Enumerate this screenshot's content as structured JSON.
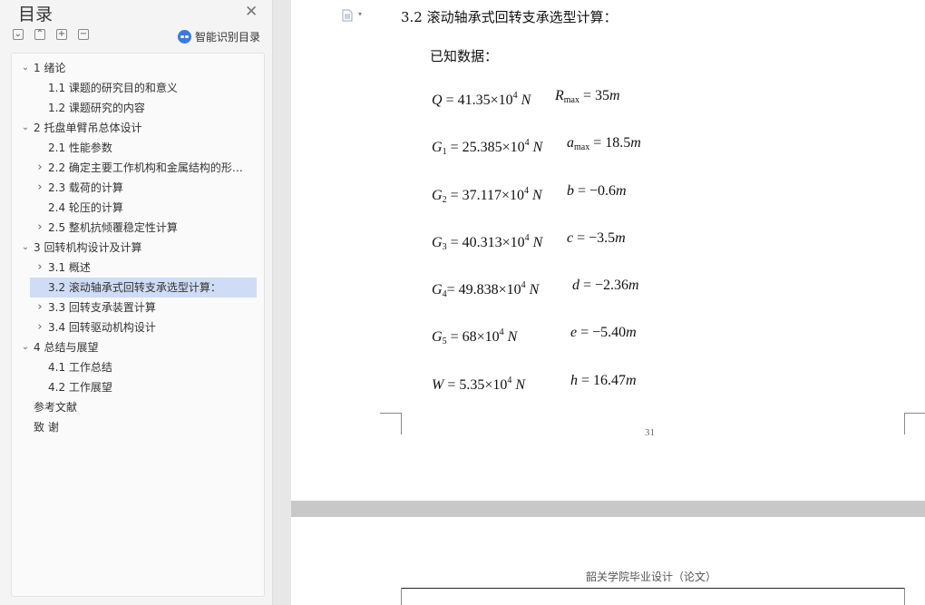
{
  "sidebar": {
    "title": "目录",
    "smart_toc_label": "智能识别目录",
    "toolbar": [
      "⌄",
      "⌃",
      "+",
      "−"
    ],
    "items": [
      {
        "text": "1  绪论",
        "level": 1,
        "chevron": "expanded",
        "active": false
      },
      {
        "text": "1.1  课题的研究目的和意义",
        "level": 2,
        "chevron": "none",
        "active": false
      },
      {
        "text": "1.2  课题研究的内容",
        "level": 2,
        "chevron": "none",
        "active": false
      },
      {
        "text": "2  托盘单臂吊总体设计",
        "level": 1,
        "chevron": "expanded",
        "active": false
      },
      {
        "text": "2.1  性能参数",
        "level": 2,
        "chevron": "none",
        "active": false
      },
      {
        "text": "2.2  确定主要工作机构和金属结构的形…",
        "level": 2,
        "chevron": "collapsed",
        "active": false
      },
      {
        "text": "2.3  载荷的计算",
        "level": 2,
        "chevron": "collapsed",
        "active": false
      },
      {
        "text": "2.4  轮压的计算",
        "level": 2,
        "chevron": "none",
        "active": false
      },
      {
        "text": "2.5  整机抗倾覆稳定性计算",
        "level": 2,
        "chevron": "collapsed",
        "active": false
      },
      {
        "text": "3  回转机构设计及计算",
        "level": 1,
        "chevron": "expanded",
        "active": false
      },
      {
        "text": "3.1  概述",
        "level": 2,
        "chevron": "collapsed",
        "active": false
      },
      {
        "text": "3.2  滚动轴承式回转支承选型计算：",
        "level": 2,
        "chevron": "none",
        "active": true
      },
      {
        "text": "3.3  回转支承装置计算",
        "level": 2,
        "chevron": "collapsed",
        "active": false
      },
      {
        "text": "3.4  回转驱动机构设计",
        "level": 2,
        "chevron": "collapsed",
        "active": false
      },
      {
        "text": "4  总结与展望",
        "level": 1,
        "chevron": "expanded",
        "active": false
      },
      {
        "text": "4.1  工作总结",
        "level": 2,
        "chevron": "none",
        "active": false
      },
      {
        "text": "4.2  工作展望",
        "level": 2,
        "chevron": "none",
        "active": false
      },
      {
        "text": "参考文献",
        "level": 1,
        "chevron": "none",
        "active": false
      },
      {
        "text": "致    谢",
        "level": 1,
        "chevron": "none",
        "active": false
      }
    ]
  },
  "doc": {
    "heading": "3.2  滚动轴承式回转支承选型计算：",
    "known_label": "已知数据：",
    "equations": [
      {
        "left": {
          "sym": "Q",
          "sub": "",
          "rhs": " = 41.35×10",
          "exp": "4",
          "unit": " N"
        },
        "right": {
          "sym": "R",
          "sub": "max",
          "rhs": " = 35",
          "unit": "m"
        }
      },
      {
        "left": {
          "sym": "G",
          "sub": "1",
          "rhs": " = 25.385×10",
          "exp": "4",
          "unit": " N"
        },
        "right": {
          "sym": "a",
          "sub": "max",
          "rhs": "  = 18.5",
          "unit": "m"
        }
      },
      {
        "left": {
          "sym": "G",
          "sub": "2",
          "rhs": " = 37.117×10",
          "exp": "4",
          "unit": " N"
        },
        "right": {
          "sym": "b",
          "sub": "",
          "rhs": " = −0.6",
          "unit": "m"
        }
      },
      {
        "left": {
          "sym": "G",
          "sub": "3",
          "rhs": " = 40.313×10",
          "exp": "4",
          "unit": " N"
        },
        "right": {
          "sym": "c",
          "sub": "",
          "rhs": " = −3.5",
          "unit": "m"
        }
      },
      {
        "left": {
          "sym": "G",
          "sub": "4",
          "rhs": "= 49.838×10",
          "exp": "4",
          "unit": " N"
        },
        "right": {
          "sym": "d",
          "sub": "",
          "rhs": " = −2.36",
          "unit": "m"
        }
      },
      {
        "left": {
          "sym": "G",
          "sub": "5",
          "rhs": " = 68×10",
          "exp": "4",
          "unit": " N"
        },
        "right": {
          "sym": "e",
          "sub": "",
          "rhs": " = −5.40",
          "unit": "m"
        }
      },
      {
        "left": {
          "sym": "W",
          "sub": "",
          "rhs": " = 5.35×10",
          "exp": "4",
          "unit": " N"
        },
        "right": {
          "sym": "h",
          "sub": "",
          "rhs": " = 16.47",
          "unit": "m"
        }
      }
    ],
    "page_number": "31",
    "next_page_header": "韶关学院毕业设计（论文）"
  }
}
